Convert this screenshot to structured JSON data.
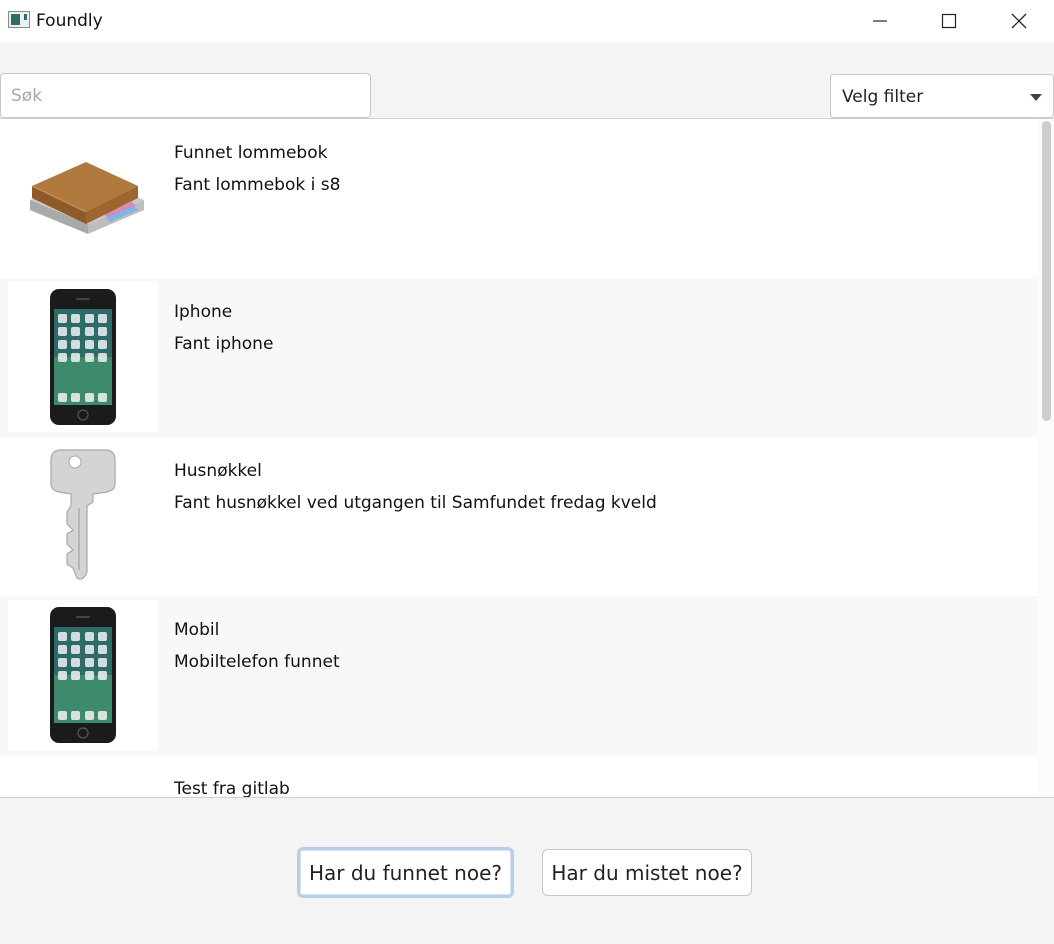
{
  "window": {
    "title": "Foundly",
    "controls": [
      "minimize-icon",
      "maximize-icon",
      "close-icon"
    ]
  },
  "toolbar": {
    "search_placeholder": "Søk",
    "search_value": "",
    "filter_label": "Velg filter"
  },
  "items": [
    {
      "title": "Funnet lommebok",
      "description": "Fant lommebok i s8",
      "image": "wallet"
    },
    {
      "title": "Iphone",
      "description": "Fant iphone",
      "image": "phone"
    },
    {
      "title": "Husnøkkel",
      "description": "Fant husnøkkel ved utgangen til Samfundet fredag kveld",
      "image": "key"
    },
    {
      "title": "Mobil",
      "description": "Mobiltelefon  funnet",
      "image": "phone"
    },
    {
      "title": "Test fra gitlab",
      "description": "",
      "image": ""
    }
  ],
  "footer": {
    "found_button": "Har du funnet noe?",
    "lost_button": "Har du mistet noe?"
  },
  "colors": {
    "focus_border": "#b9cee8",
    "row_alt": "#f8f8f8",
    "window_bg": "#f4f4f4"
  }
}
